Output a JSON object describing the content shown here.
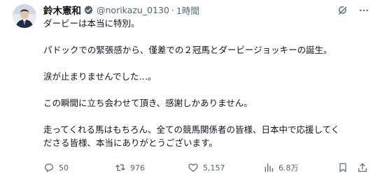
{
  "author": {
    "name": "鈴木憲和",
    "handle": "@norikazu_0130",
    "separator": "·",
    "time": "1時間"
  },
  "tweet": {
    "lines": [
      "ダービーは本当に特別。",
      "",
      "パドックでの緊張感から、僅差での２冠馬とダービージョッキーの誕生。",
      "",
      "涙が止まりませんでした…。",
      "",
      "この瞬間に立ち会わせて頂き、感謝しかありません。",
      "",
      "走ってくれる馬はもちろん、全ての競馬関係者の皆様、日本中で応援してく",
      "ださる皆様、本当にありがとうございます。"
    ]
  },
  "actions": {
    "replies": "50",
    "retweets": "976",
    "likes": "5,157",
    "views": "6.8万"
  },
  "icons": {
    "verified": "verified-badge-icon",
    "grok": "grok-icon",
    "more": "more-icon",
    "reply": "reply-icon",
    "retweet": "retweet-icon",
    "like": "heart-icon",
    "views": "views-bar-chart-icon",
    "bookmark": "bookmark-icon",
    "share": "share-icon"
  },
  "colors": {
    "text": "#0f1419",
    "secondary": "#536471",
    "verified_gold": "#e2b719"
  }
}
